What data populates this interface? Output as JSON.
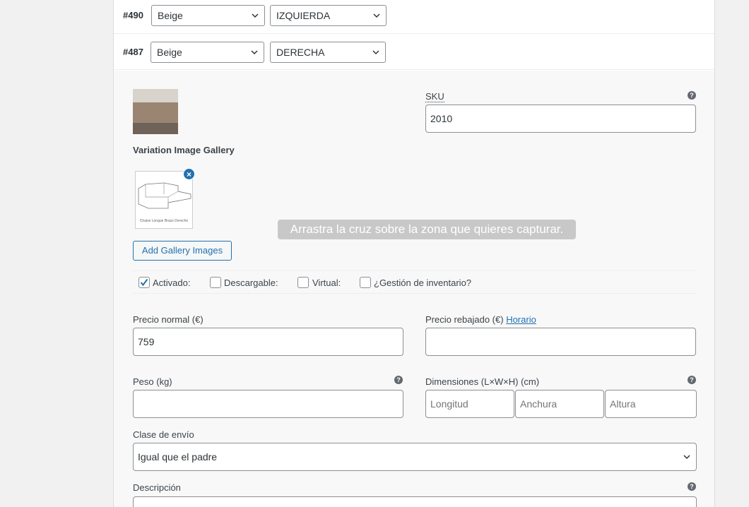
{
  "variations": [
    {
      "id": "#490",
      "color": "Beige",
      "side": "IZQUIERDA"
    },
    {
      "id": "#487",
      "color": "Beige",
      "side": "DERECHA"
    }
  ],
  "sku": {
    "label": "SKU",
    "value": "2010"
  },
  "gallery": {
    "label": "Variation Image Gallery",
    "image_caption": "Chaise Longue Brazo Derecho",
    "add_button": "Add Gallery Images"
  },
  "overlay_text": "Arrastra la cruz sobre la zona que quieres capturar.",
  "options": {
    "enabled": "Activado:",
    "downloadable": "Descargable:",
    "virtual": "Virtual:",
    "manage_stock": "¿Gestión de inventario?"
  },
  "pricing": {
    "regular_label": "Precio normal (€)",
    "regular_value": "759",
    "sale_label": "Precio rebajado (€)",
    "sale_link": "Horario",
    "sale_value": ""
  },
  "weight": {
    "label": "Peso (kg)",
    "value": ""
  },
  "dimensions": {
    "label": "Dimensiones (L×W×H) (cm)",
    "length_placeholder": "Longitud",
    "width_placeholder": "Anchura",
    "height_placeholder": "Altura"
  },
  "shipping": {
    "label": "Clase de envío",
    "value": "Igual que el padre"
  },
  "description": {
    "label": "Descripción"
  },
  "help_glyph": "?",
  "colors": {
    "accent": "#2271b1",
    "border": "#8c8f94"
  }
}
